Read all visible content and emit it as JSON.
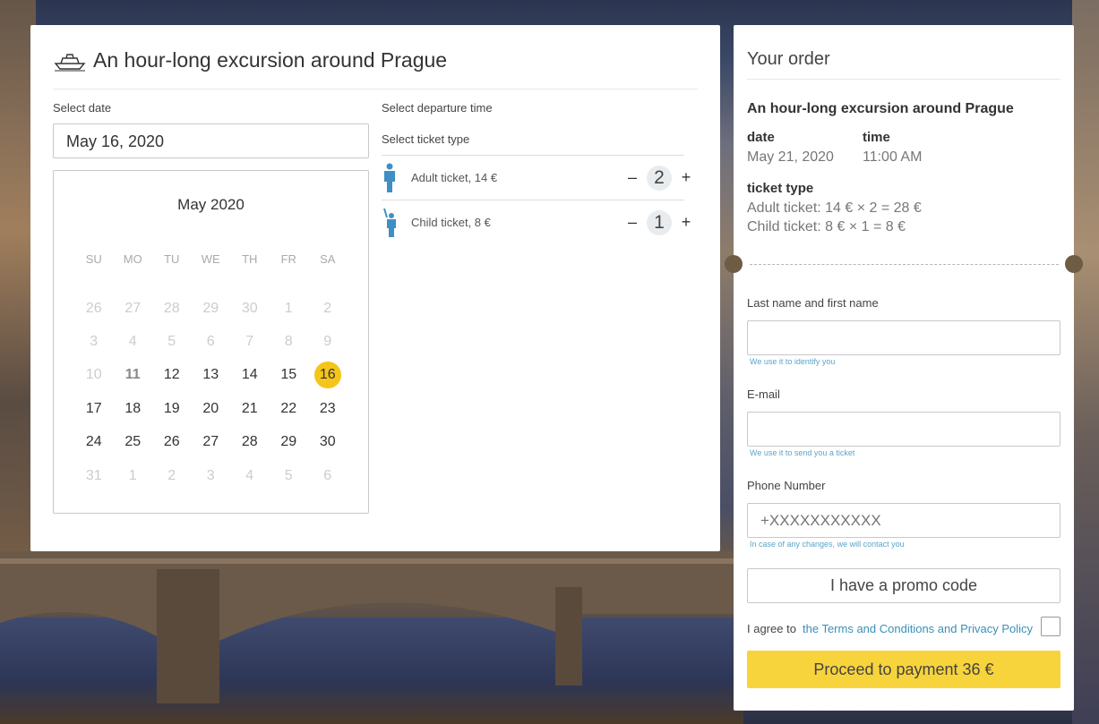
{
  "tour": {
    "title": "An hour-long excursion around Prague",
    "select_date_label": "Select date",
    "date_value": "May 16, 2020",
    "departure_label": "Select departure time",
    "ticket_type_label": "Select ticket type"
  },
  "calendar": {
    "month": "May 2020",
    "weekdays": [
      "SU",
      "MO",
      "TU",
      "WE",
      "TH",
      "FR",
      "SA"
    ],
    "weeks": [
      [
        "26",
        "27",
        "28",
        "29",
        "30",
        "1",
        "2"
      ],
      [
        "3",
        "4",
        "5",
        "6",
        "7",
        "8",
        "9"
      ],
      [
        "10",
        "11",
        "12",
        "13",
        "14",
        "15",
        "16"
      ],
      [
        "17",
        "18",
        "19",
        "20",
        "21",
        "22",
        "23"
      ],
      [
        "24",
        "25",
        "26",
        "27",
        "28",
        "29",
        "30"
      ],
      [
        "31",
        "1",
        "2",
        "3",
        "4",
        "5",
        "6"
      ]
    ],
    "selected": "16"
  },
  "tickets": [
    {
      "name": "Adult ticket, 14 €",
      "qty": "2",
      "minus": "–",
      "plus": "+",
      "icon": "adult-person-icon"
    },
    {
      "name": "Child ticket, 8 €",
      "qty": "1",
      "minus": "–",
      "plus": "+",
      "icon": "child-person-icon"
    }
  ],
  "order": {
    "title": "Your order",
    "tour_name": "An hour-long excursion around Prague",
    "date_label": "date",
    "date_value": "May 21, 2020",
    "time_label": "time",
    "time_value": "11:00 AM",
    "ticket_type_label": "ticket type",
    "adult_line": "Adult ticket: 14 € × 2 = 28 €",
    "child_line": "Child ticket: 8 € × 1 = 8 €"
  },
  "form": {
    "name_label": "Last name and first name",
    "name_hint": "We use it to identify you",
    "name_value": "",
    "email_label": "E-mail",
    "email_hint": "We use it to send you a ticket",
    "email_value": "",
    "phone_label": "Phone Number",
    "phone_placeholder": "+XXXXXXXXXXX",
    "phone_hint": "In case of any changes, we will contact you",
    "promo_button": "I have a promo code",
    "agree_text": "I agree to",
    "agree_link": "the Terms and Conditions and Privacy Policy",
    "pay_button": "Proceed to payment 36 €"
  },
  "colors": {
    "accent_yellow": "#f7d43c",
    "selected_day": "#f5c519",
    "link_blue": "#3a8fb7",
    "icon_blue": "#3f8fc4"
  }
}
